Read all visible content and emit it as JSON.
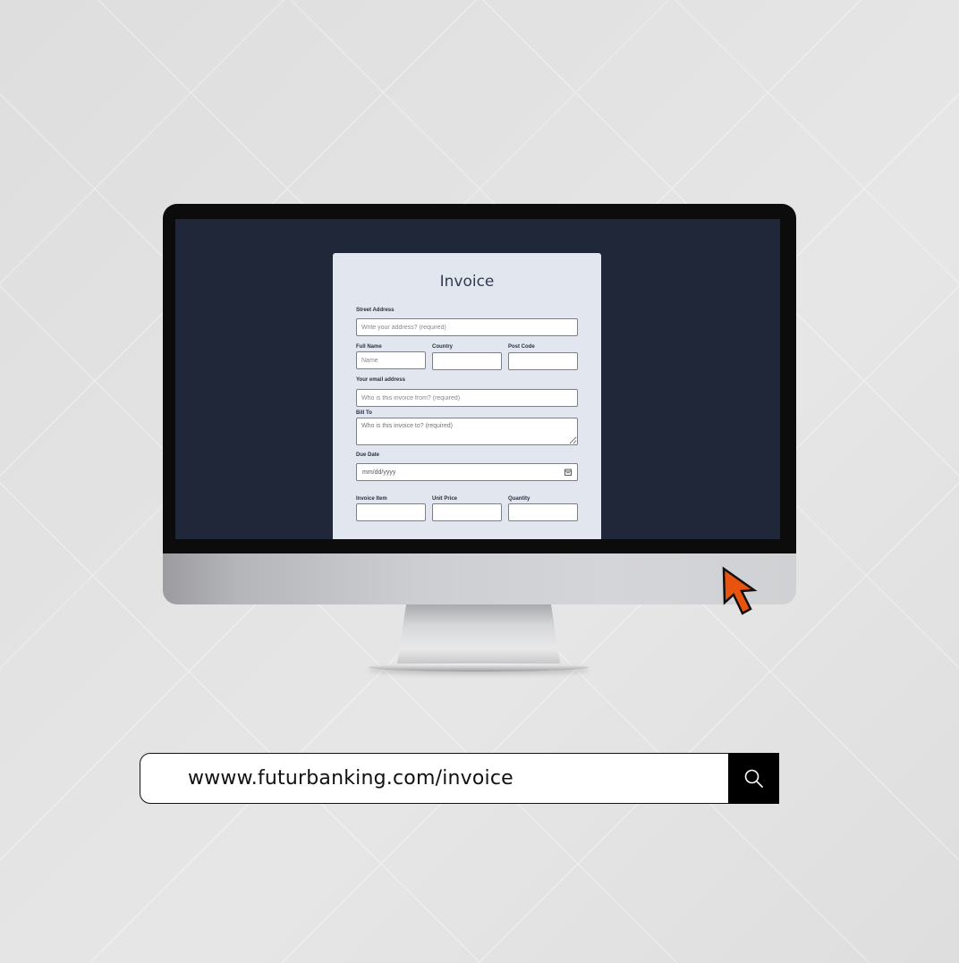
{
  "invoice": {
    "title": "Invoice",
    "street_address": {
      "label": "Street Address",
      "placeholder": "Write your address? (required)"
    },
    "full_name": {
      "label": "Full Name",
      "placeholder": "Name"
    },
    "country": {
      "label": "Country",
      "placeholder": ""
    },
    "post_code": {
      "label": "Post Code",
      "placeholder": ""
    },
    "email": {
      "label": "Your email address",
      "placeholder": "Who is this invoice from? (required)"
    },
    "bill_to": {
      "label": "Bill To",
      "placeholder": "Who is this invoice to? (required)"
    },
    "due_date": {
      "label": "Due Date",
      "placeholder": "mm/dd/yyyy"
    },
    "invoice_item": {
      "label": "Invoice Item",
      "placeholder": ""
    },
    "unit_price": {
      "label": "Unit Price",
      "placeholder": ""
    },
    "quantity": {
      "label": "Quantity",
      "placeholder": ""
    }
  },
  "url_bar": {
    "url": "wwww.futurbanking.com/invoice"
  },
  "icons": {
    "calendar": "calendar-icon",
    "cursor": "cursor-arrow-icon",
    "search": "search-icon"
  },
  "colors": {
    "background": "#dedede",
    "screen": "#1f2738",
    "form_card": "#e1e6ef",
    "cursor": "#e8540e",
    "search_button": "#000000"
  }
}
